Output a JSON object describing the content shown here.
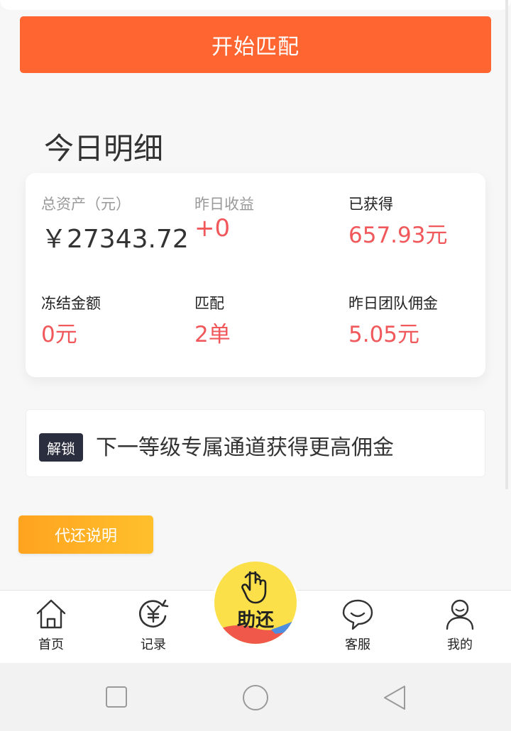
{
  "actions": {
    "start_match": "开始匹配"
  },
  "today": {
    "title": "今日明细",
    "stats": {
      "total_assets": {
        "label": "总资产（元）",
        "value": "￥27343.72"
      },
      "yesterday_income": {
        "label": "昨日收益",
        "value": "+0"
      },
      "earned": {
        "label": "已获得",
        "value": "657.93元"
      },
      "frozen": {
        "label": "冻结金额",
        "value": "0元"
      },
      "matched": {
        "label": "匹配",
        "value": "2单"
      },
      "team_commission": {
        "label": "昨日团队佣金",
        "value": "5.05元"
      }
    }
  },
  "unlock": {
    "badge": "解锁",
    "text": "下一等级专属通道获得更高佣金"
  },
  "repay_info": {
    "label": "代还说明"
  },
  "tabbar": {
    "items": [
      {
        "label": "首页",
        "icon": "home-icon"
      },
      {
        "label": "记录",
        "icon": "yen-record-icon"
      },
      {
        "label": "客服",
        "icon": "chat-bubble-icon"
      },
      {
        "label": "我的",
        "icon": "user-icon"
      }
    ],
    "center": {
      "label": "助还",
      "icon": "tap-hand-icon"
    }
  },
  "colors": {
    "primary_orange": "#ff6531",
    "value_red": "#f0585b",
    "badge_dark": "#2b2e3e",
    "button_yellow": "#ffb326",
    "center_yellow": "#fbe04a"
  }
}
